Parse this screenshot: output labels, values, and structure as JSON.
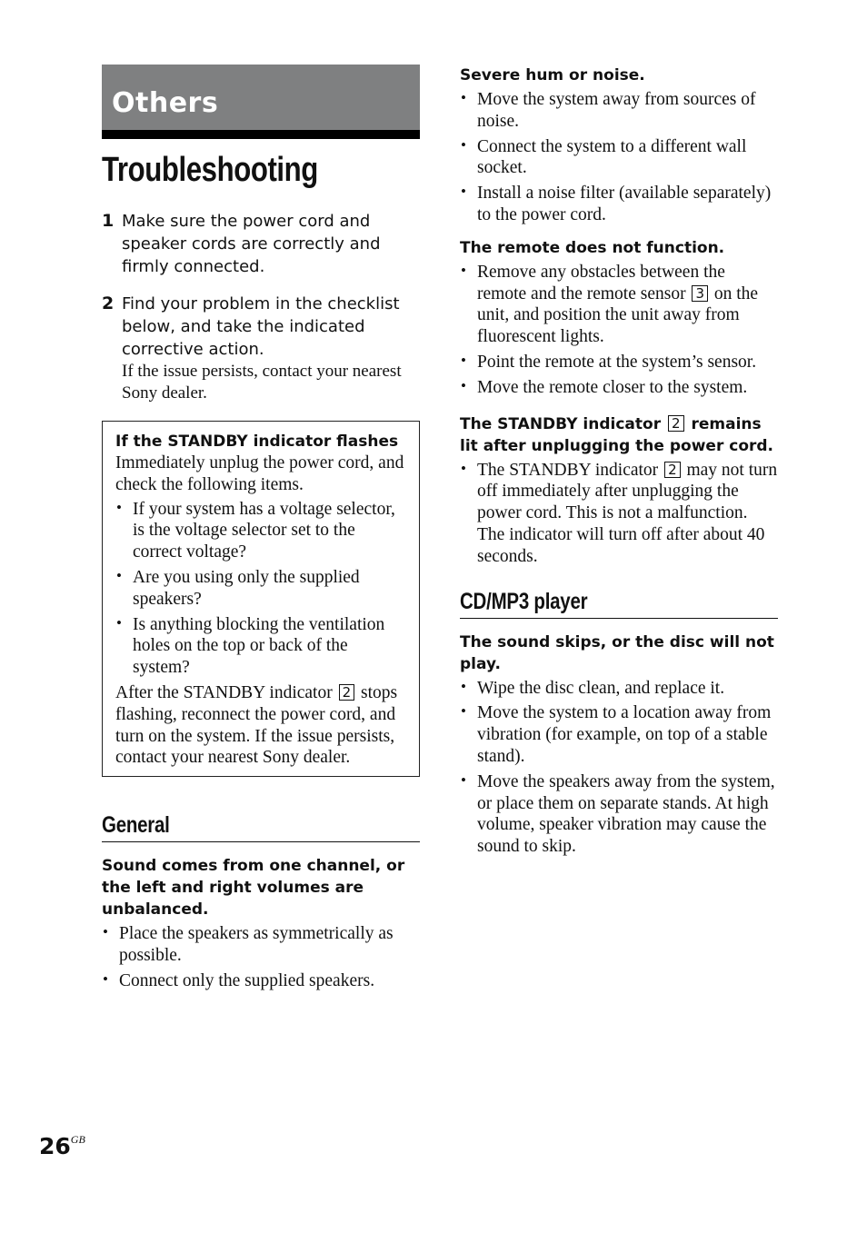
{
  "section": {
    "label": "Others",
    "band_color": "#7f8081"
  },
  "page_title": "Troubleshooting",
  "steps": [
    {
      "num": "1",
      "text": "Make sure the power cord and speaker cords are correctly and firmly connected.",
      "note": ""
    },
    {
      "num": "2",
      "text": "Find your problem in the checklist below, and take the indicated corrective action.",
      "note": "If the issue persists, contact your nearest Sony dealer."
    }
  ],
  "standby_box": {
    "heading": "If the STANDBY indicator flashes",
    "intro": "Immediately unplug the power cord, and check the following items.",
    "bullets": [
      "If your system has a voltage selector, is the voltage selector set to the correct voltage?",
      "Are you using only the supplied speakers?",
      "Is anything blocking the ventilation holes on the top or back of the system?"
    ],
    "after_pre": "After the STANDBY indicator",
    "after_ref": "2",
    "after_post": "stops flashing, reconnect the power cord, and turn on the system. If the issue persists, contact your nearest Sony dealer."
  },
  "general": {
    "heading": "General",
    "problems": [
      {
        "question": "Sound comes from one channel, or the left and right volumes are unbalanced.",
        "bullets": [
          "Place the speakers as symmetrically as possible.",
          "Connect only the supplied speakers."
        ]
      },
      {
        "question": "Severe hum or noise.",
        "bullets": [
          "Move the system away from sources of noise.",
          "Connect the system to a different wall socket.",
          "Install a noise filter (available separately) to the power cord."
        ]
      },
      {
        "question": "The remote does not function.",
        "bullet1_pre": "Remove any obstacles between the remote and the remote sensor",
        "bullet1_ref": "3",
        "bullet1_post": "on the unit, and position the unit away from fluorescent lights.",
        "bullets": [
          "Point the remote at the system’s sensor.",
          "Move the remote closer to the system."
        ]
      },
      {
        "question_pre": "The STANDBY indicator",
        "question_ref": "2",
        "question_post": "remains lit after unplugging the power cord.",
        "bullet1_pre": "The STANDBY indicator",
        "bullet1_ref": "2",
        "bullet1_post": "may not turn off immediately after unplugging the power cord. This is not a malfunction. The indicator will turn off after about 40 seconds."
      }
    ]
  },
  "cdmp3": {
    "heading": "CD/MP3 player",
    "problems": [
      {
        "question": "The sound skips, or the disc will not play.",
        "bullets": [
          "Wipe the disc clean, and replace it.",
          "Move the system to a location away from vibration (for example, on top of a stable stand).",
          "Move the speakers away from the system, or place them on separate stands. At high volume, speaker vibration may cause the sound to skip."
        ]
      }
    ]
  },
  "footer": {
    "page_number": "26",
    "suffix": "GB"
  },
  "bullet_glyph": "•"
}
